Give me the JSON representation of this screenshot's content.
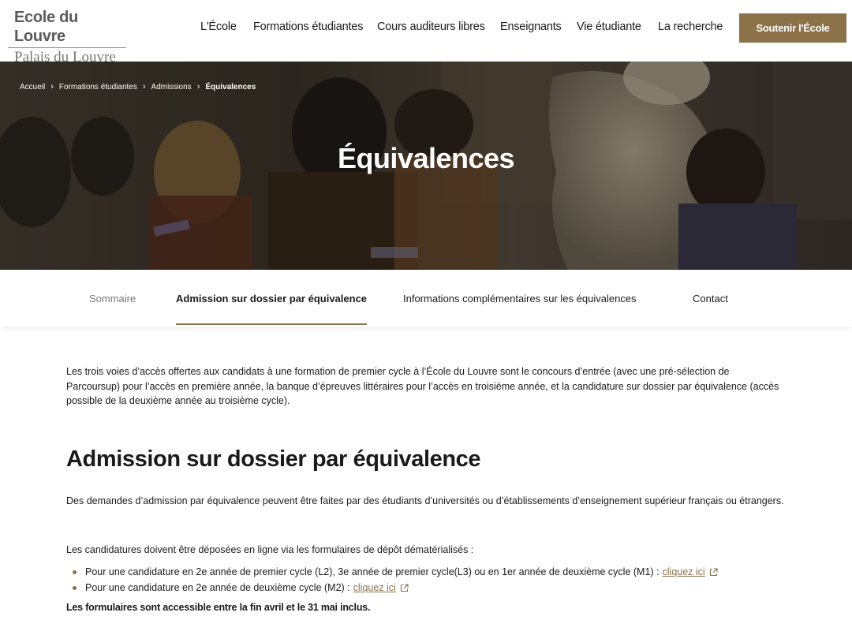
{
  "logo": {
    "line1": "Ecole du Louvre",
    "line2": "Palais du Louvre"
  },
  "nav": {
    "items": [
      {
        "label": "L'École"
      },
      {
        "label": "Formations étudiantes"
      },
      {
        "label": "Cours auditeurs libres"
      },
      {
        "label": "Enseignants"
      },
      {
        "label": "Vie étudiante"
      },
      {
        "label": "La recherche"
      }
    ],
    "support_label": "Soutenir l'École"
  },
  "breadcrumb": {
    "items": [
      "Accueil",
      "Formations étudiantes",
      "Admissions"
    ],
    "current": "Équivalences"
  },
  "hero": {
    "title": "Équivalences"
  },
  "tabs": [
    {
      "label": "Sommaire"
    },
    {
      "label": "Admission sur dossier par équivalence"
    },
    {
      "label": "Informations complémentaires sur les équivalences"
    },
    {
      "label": "Contact"
    }
  ],
  "content": {
    "intro": "Les trois voies d’accès offertes aux candidats à une formation de premier cycle à l’École du Louvre sont le concours d’entrée (avec une pré-sélection de Parcoursup) pour l’accès en première année, la banque d’épreuves littéraires pour l’accès en troisième année, et la candidature sur dossier par équivalence (accès possible de la deuxième année au troisième cycle).",
    "heading": "Admission sur dossier par équivalence",
    "para1": "Des demandes d’admission par équivalence peuvent être faites par des étudiants d’universités ou d’établissements d’enseignement supérieur français ou étrangers.",
    "para2": "Les candidatures doivent être déposées en ligne via les formulaires de dépôt dématérialisés :",
    "list": [
      {
        "text": "Pour une candidature en 2e année de premier cycle (L2), 3e année de premier cycle(L3) ou en 1er année de deuxième cycle (M1) :",
        "link": "cliquez ici"
      },
      {
        "text": "Pour une candidature en 2e année de deuxième cycle (M2) :",
        "link": "cliquez ici"
      }
    ],
    "note": "Les formulaires sont accessible entre la fin avril et le 31 mai inclus."
  },
  "colors": {
    "accent": "#8b7249",
    "text": "#1a1a1a",
    "muted": "#777777"
  },
  "icons": [
    "external-link-icon",
    "chevron-right-icon",
    "bullet-icon"
  ]
}
